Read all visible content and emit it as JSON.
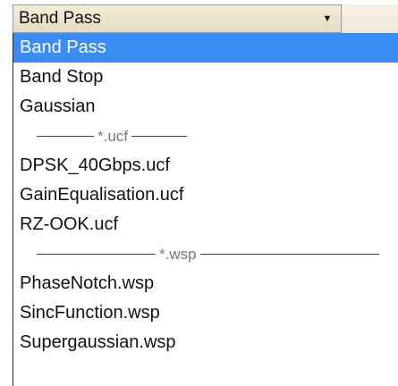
{
  "select": {
    "value": "Band Pass",
    "arrow_icon": "triangle-down-icon"
  },
  "options": {
    "o0": "Band Pass",
    "o1": "Band Stop",
    "o2": "Gaussian",
    "sep_ucf": "*.ucf",
    "o3": "DPSK_40Gbps.ucf",
    "o4": "GainEqualisation.ucf",
    "o5": "RZ-OOK.ucf",
    "sep_wsp": "*.wsp",
    "o6": "PhaseNotch.wsp",
    "o7": "SincFunction.wsp",
    "o8": "Supergaussian.wsp"
  },
  "colors": {
    "selected_bg": "#3b8cf2",
    "select_bg": "#efe6d0"
  }
}
